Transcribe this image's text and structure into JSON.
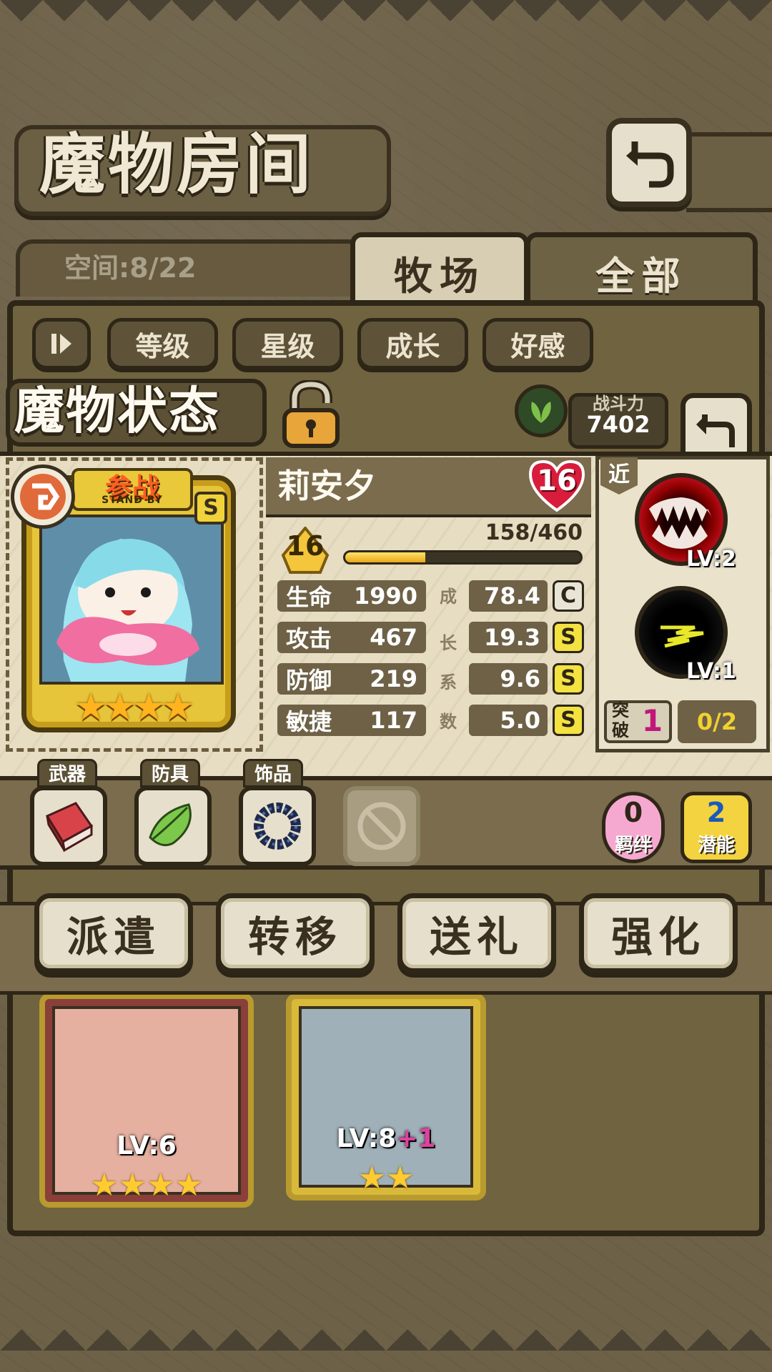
{
  "header": {
    "title": "魔物房间"
  },
  "room": {
    "space_text": "空间:8/22",
    "tabs": [
      "牧场",
      "全部"
    ],
    "sort_buttons": [
      "等级",
      "星级",
      "成长",
      "好感"
    ]
  },
  "background_cards": [
    {
      "level": "LV:6",
      "stars": "★★★★"
    },
    {
      "level": "LV:8",
      "level_bonus": "+1",
      "stars": "★★"
    }
  ],
  "status": {
    "title": "魔物状态",
    "power_label": "战斗力",
    "power_value": "7402",
    "standby_main": "参战",
    "standby_sub": "STAND BY",
    "rank": "S",
    "stars": "★★★★"
  },
  "monster": {
    "name": "莉安夕",
    "affection": "16",
    "level": "16",
    "exp_text": "158/460",
    "exp_progress": 0.34,
    "stats": [
      {
        "label": "生命",
        "value": "1990",
        "growth": "78.4",
        "grade": "C"
      },
      {
        "label": "攻击",
        "value": "467",
        "growth": "19.3",
        "grade": "S"
      },
      {
        "label": "防御",
        "value": "219",
        "growth": "9.6",
        "grade": "S"
      },
      {
        "label": "敏捷",
        "value": "117",
        "growth": "5.0",
        "grade": "S"
      }
    ],
    "growth_chars": [
      "成",
      "长",
      "系",
      "数"
    ]
  },
  "skills": {
    "range": "近",
    "skill1_level": "LV:2",
    "skill2_level": "LV:1",
    "break_label": "突破",
    "break_value": "1",
    "break_progress": "0/2"
  },
  "equipment": {
    "labels": [
      "武器",
      "防具",
      "饰品"
    ],
    "bond_value": "0",
    "bond_label": "羁绊",
    "potential_value": "2",
    "potential_label": "潜能"
  },
  "actions": [
    "派遣",
    "转移",
    "送礼",
    "强化"
  ]
}
